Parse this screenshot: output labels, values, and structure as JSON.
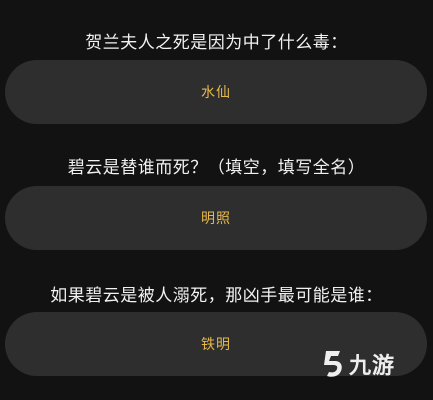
{
  "questions": [
    {
      "text": "贺兰夫人之死是因为中了什么毒：",
      "answer": "水仙"
    },
    {
      "text": "碧云是替谁而死？（填空，填写全名）",
      "answer": "明照"
    },
    {
      "text": "如果碧云是被人溺死，那凶手最可能是谁：",
      "answer": "铁明"
    }
  ],
  "watermark": {
    "icon": "jiuyou-logo-icon",
    "text": "九游"
  },
  "colors": {
    "background": "#121212",
    "pill": "#2e2e2e",
    "question_text": "#f2f2f2",
    "answer_text": "#e6b94a"
  }
}
